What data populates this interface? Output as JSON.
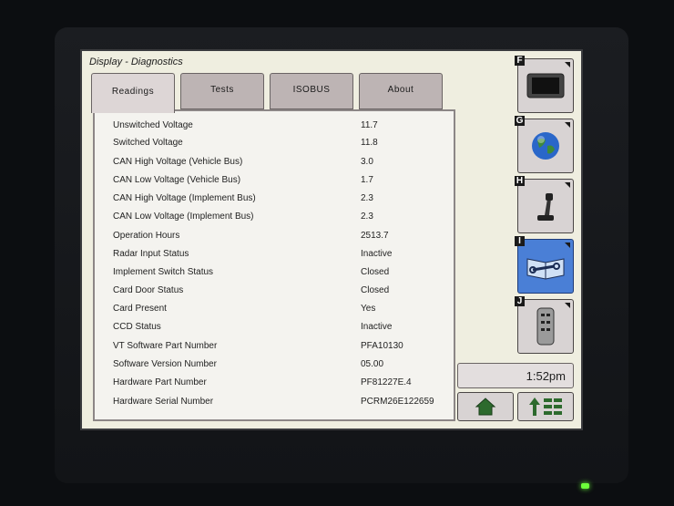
{
  "window": {
    "title": "Display - Diagnostics"
  },
  "tabs": [
    {
      "label": "Readings",
      "active": true
    },
    {
      "label": "Tests",
      "active": false
    },
    {
      "label": "ISOBUS",
      "active": false
    },
    {
      "label": "About",
      "active": false
    }
  ],
  "readings": [
    {
      "label": "Unswitched Voltage",
      "value": "11.7"
    },
    {
      "label": "Switched Voltage",
      "value": "11.8"
    },
    {
      "label": "CAN High Voltage (Vehicle Bus)",
      "value": "3.0"
    },
    {
      "label": "CAN Low Voltage (Vehicle Bus)",
      "value": "1.7"
    },
    {
      "label": "CAN High Voltage (Implement Bus)",
      "value": "2.3"
    },
    {
      "label": "CAN Low Voltage (Implement Bus)",
      "value": "2.3"
    },
    {
      "label": "Operation Hours",
      "value": "2513.7"
    },
    {
      "label": "Radar Input Status",
      "value": "Inactive"
    },
    {
      "label": "Implement Switch Status",
      "value": "Closed"
    },
    {
      "label": "Card Door Status",
      "value": "Closed"
    },
    {
      "label": "Card Present",
      "value": "Yes"
    },
    {
      "label": "CCD Status",
      "value": "Inactive"
    },
    {
      "label": "VT Software Part Number",
      "value": "PFA10130"
    },
    {
      "label": "Software Version Number",
      "value": "05.00"
    },
    {
      "label": "Hardware Part Number",
      "value": "PF81227E.4"
    },
    {
      "label": "Hardware Serial Number",
      "value": "PCRM26E122659"
    }
  ],
  "side_buttons": [
    {
      "letter": "F",
      "icon": "display-icon"
    },
    {
      "letter": "G",
      "icon": "globe-icon"
    },
    {
      "letter": "H",
      "icon": "joystick-icon"
    },
    {
      "letter": "I",
      "icon": "wrench-manual-icon",
      "active": true
    },
    {
      "letter": "J",
      "icon": "remote-icon"
    }
  ],
  "status": {
    "time": "1:52pm"
  },
  "bottom_buttons": [
    {
      "icon": "home-icon"
    },
    {
      "icon": "menu-up-icon"
    }
  ],
  "colors": {
    "screen_bg": "#efeee0",
    "active_button": "#4a7fd6",
    "tab": "#bdb4b4"
  }
}
